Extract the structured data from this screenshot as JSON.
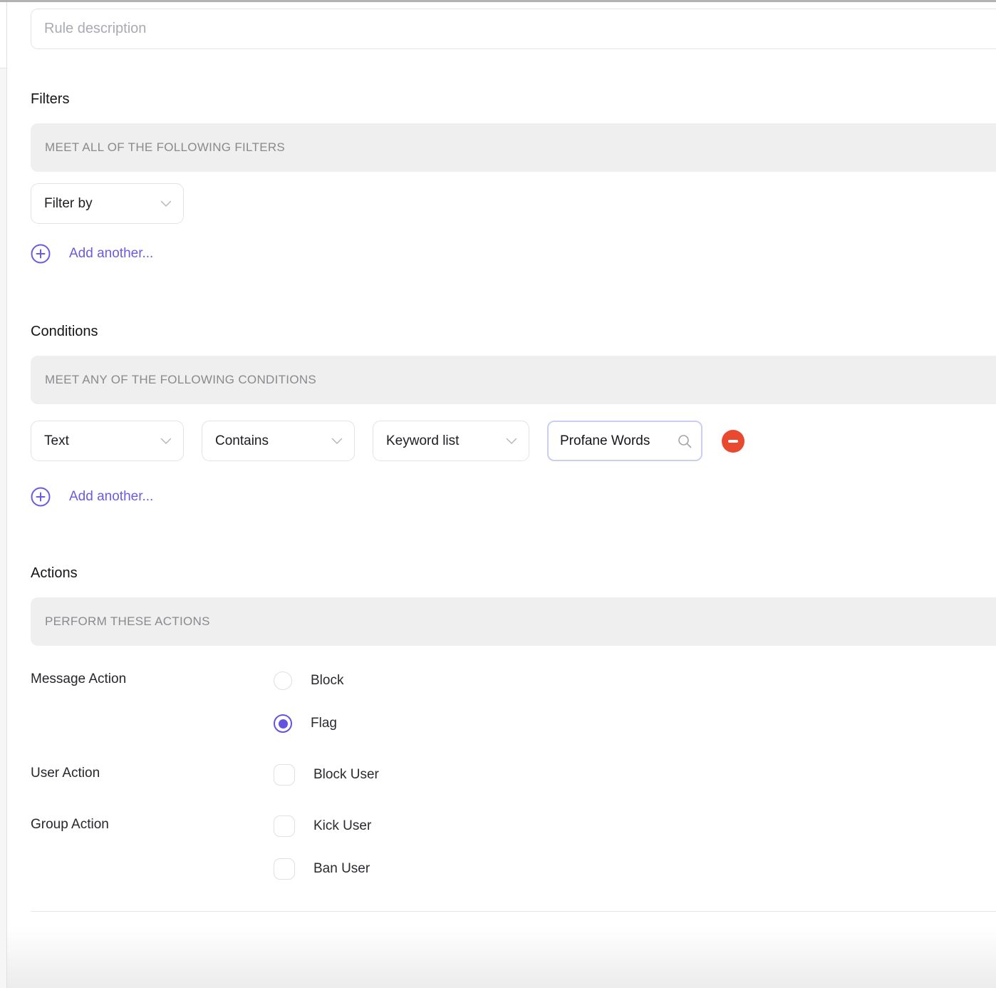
{
  "colors": {
    "accent": "#6a5be0",
    "accent_radio": "#6554e0",
    "danger": "#e8492f",
    "section_bar_bg": "#efefef",
    "value_input_border": "#c7cff2"
  },
  "rule": {
    "description_placeholder": "Rule description",
    "description_value": ""
  },
  "filters": {
    "heading": "Filters",
    "bar_label": "MEET ALL OF THE FOLLOWING FILTERS",
    "filter_by_value": "Filter by",
    "add_another_label": "Add another..."
  },
  "conditions": {
    "heading": "Conditions",
    "bar_label": "MEET ANY OF THE FOLLOWING CONDITIONS",
    "row": {
      "field": "Text",
      "operator": "Contains",
      "value_type": "Keyword list",
      "value": "Profane Words"
    },
    "add_another_label": "Add another..."
  },
  "actions": {
    "heading": "Actions",
    "bar_label": "PERFORM THESE ACTIONS",
    "message_action": {
      "label": "Message Action",
      "options": [
        {
          "label": "Block",
          "selected": false
        },
        {
          "label": "Flag",
          "selected": true
        }
      ]
    },
    "user_action": {
      "label": "User Action",
      "options": [
        {
          "label": "Block User",
          "checked": false
        }
      ]
    },
    "group_action": {
      "label": "Group Action",
      "options": [
        {
          "label": "Kick User",
          "checked": false
        },
        {
          "label": "Ban User",
          "checked": false
        }
      ]
    }
  }
}
